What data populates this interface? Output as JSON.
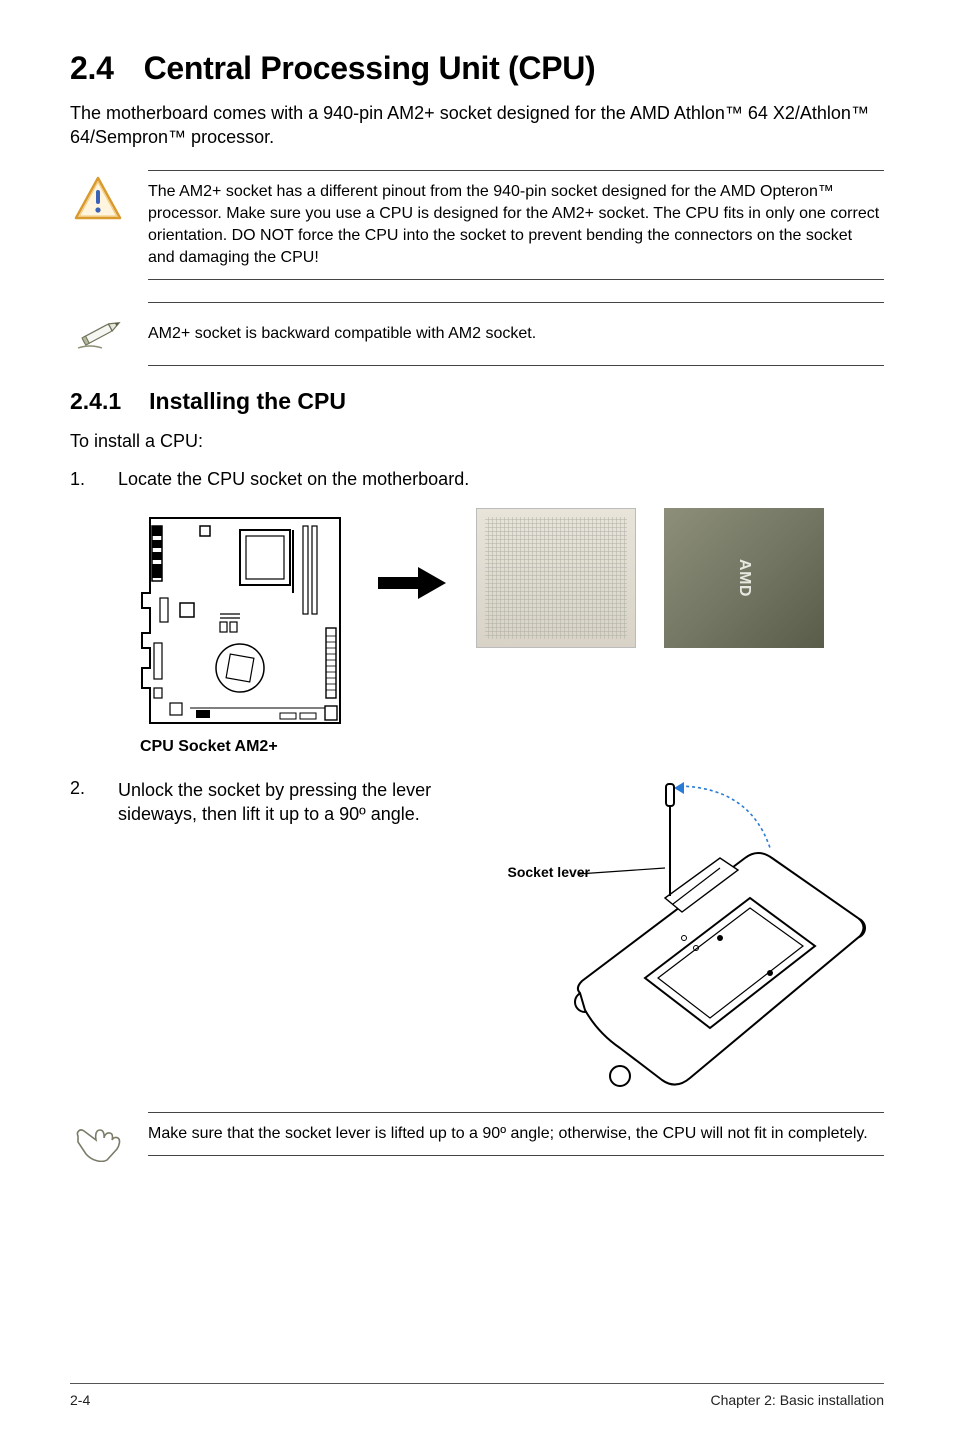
{
  "section": {
    "number": "2.4",
    "title": "Central Processing Unit (CPU)"
  },
  "intro": "The motherboard comes with a 940-pin AM2+ socket designed for the AMD Athlon™ 64 X2/Athlon™ 64/Sempron™ processor.",
  "caution": "The AM2+ socket has a different pinout from the 940-pin socket designed for the AMD Opteron™ processor. Make sure you use a CPU is designed for the AM2+ socket. The CPU fits in only one correct orientation. DO NOT force the CPU into the socket to prevent bending the connectors on the socket and damaging the CPU!",
  "info": "AM2+ socket is backward compatible with AM2 socket.",
  "subsection": {
    "number": "2.4.1",
    "title": "Installing the CPU"
  },
  "install_lead": "To install a CPU:",
  "steps": {
    "s1": {
      "num": "1.",
      "text": "Locate the CPU socket on the motherboard."
    },
    "s2": {
      "num": "2.",
      "text": "Unlock the socket by pressing the lever sideways, then lift it up to a 90º angle."
    }
  },
  "figure": {
    "mobo_caption": "CPU Socket AM2+",
    "socket_lever_label": "Socket lever",
    "amd_text": "AMD"
  },
  "tip": "Make sure that the socket lever is lifted up to a 90º angle; otherwise, the CPU will not fit in completely.",
  "footer": {
    "left": "2-4",
    "right": "Chapter 2: Basic installation"
  }
}
